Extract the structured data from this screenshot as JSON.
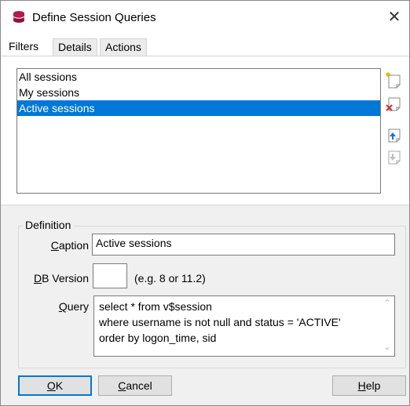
{
  "window": {
    "title": "Define Session Queries",
    "close_glyph": "✕"
  },
  "tabs": [
    {
      "label": "Filters",
      "selected": true
    },
    {
      "label": "Details",
      "selected": false
    },
    {
      "label": "Actions",
      "selected": false
    }
  ],
  "queries": [
    {
      "label": "All sessions",
      "selected": false
    },
    {
      "label": "My sessions",
      "selected": false
    },
    {
      "label": "Active sessions",
      "selected": true
    }
  ],
  "toolbar": {
    "icons": [
      "new-query-icon",
      "delete-query-icon",
      "move-up-icon",
      "move-down-icon"
    ]
  },
  "definition": {
    "group_label": "Definition",
    "caption": {
      "accel": "C",
      "rest": "aption",
      "value": "Active sessions"
    },
    "db_version": {
      "accel": "D",
      "rest": "B Version",
      "value": "",
      "hint": "(e.g. 8 or 11.2)"
    },
    "query": {
      "accel": "Q",
      "rest": "uery",
      "line1": "select * from v$session",
      "line2": "where username is not null and status = 'ACTIVE'",
      "line3": "order by logon_time, sid"
    }
  },
  "buttons": {
    "ok": {
      "accel": "O",
      "rest": "K"
    },
    "cancel": {
      "accel": "C",
      "rest": "ancel"
    },
    "help": {
      "accel": "H",
      "rest": "elp"
    }
  },
  "colors": {
    "selection": "#0078d7",
    "app_icon": "#b01e4d",
    "delete_x": "#d32f2f",
    "arrow": "#1e6fd9"
  }
}
